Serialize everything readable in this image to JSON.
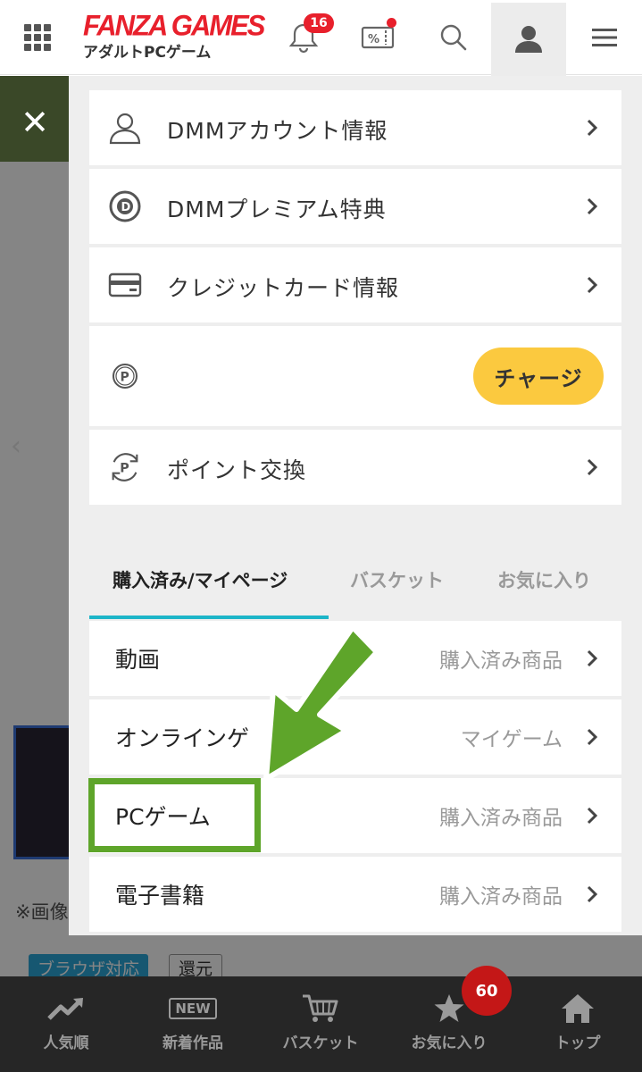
{
  "header": {
    "logo_text": "FANZA GAMES",
    "logo_subtitle": "アダルトPCゲーム",
    "notification_count": "16",
    "brand_color": "#e8202c",
    "icons": [
      "grid-icon",
      "bell-icon",
      "coupon-icon",
      "search-icon",
      "user-icon",
      "hamburger-menu-icon"
    ]
  },
  "background": {
    "note_text": "※画像",
    "tag_browser": "ブラウザ対応",
    "tag_return": "還元"
  },
  "account_menu": {
    "items": [
      {
        "label": "DMMアカウント情報",
        "icon": "person-icon"
      },
      {
        "label": "DMMプレミアム特典",
        "icon": "dmm-premium-icon"
      },
      {
        "label": "クレジットカード情報",
        "icon": "credit-card-icon"
      },
      {
        "label": "",
        "icon": "point-icon",
        "button": "チャージ"
      },
      {
        "label": "ポイント交換",
        "icon": "point-exchange-icon"
      }
    ]
  },
  "tabs": [
    {
      "label": "購入済み/マイページ",
      "active": true
    },
    {
      "label": "バスケット",
      "active": false
    },
    {
      "label": "お気に入り",
      "active": false
    }
  ],
  "accent_color": "#1cb5c8",
  "purchase_rows": [
    {
      "name": "動画",
      "sub": "購入済み商品"
    },
    {
      "name": "オンラインゲ",
      "sub": "マイゲーム"
    },
    {
      "name": "PCゲーム",
      "sub": "購入済み商品"
    },
    {
      "name": "電子書籍",
      "sub": "購入済み商品"
    }
  ],
  "annotation": {
    "color": "#5ea52a",
    "highlighted_item": "PCゲーム"
  },
  "bottom_nav": {
    "items": [
      {
        "label": "人気順",
        "icon": "trending-icon"
      },
      {
        "label": "新着作品",
        "icon": "new-badge-icon",
        "icon_text": "NEW"
      },
      {
        "label": "バスケット",
        "icon": "cart-icon"
      },
      {
        "label": "お気に入り",
        "icon": "star-icon"
      },
      {
        "label": "トップ",
        "icon": "home-icon"
      }
    ],
    "favorites_count": "60"
  }
}
